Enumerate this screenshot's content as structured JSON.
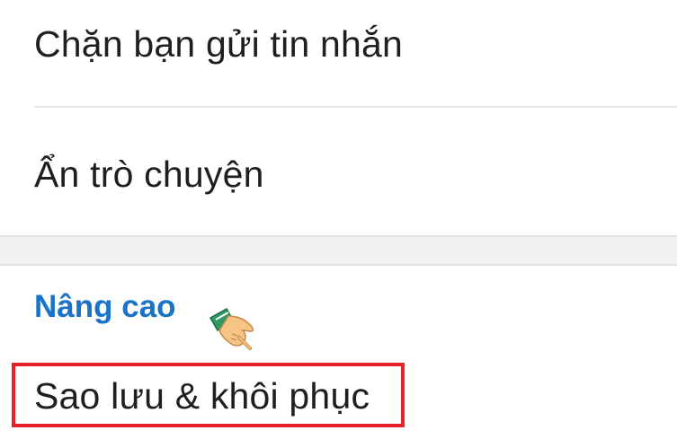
{
  "menu": {
    "items": [
      {
        "label": "Chặn bạn gửi tin nhắn"
      },
      {
        "label": "Ẩn trò chuyện"
      }
    ]
  },
  "advanced_section": {
    "header": "Nâng cao",
    "items": [
      {
        "label": "Sao lưu & khôi phục"
      }
    ]
  },
  "colors": {
    "section_header": "#1b73c8",
    "highlight": "#e8202a",
    "pointer_sleeve": "#2e9a63",
    "pointer_skin": "#f6c583"
  },
  "icons": {
    "pointer": "pointing-hand-icon"
  }
}
